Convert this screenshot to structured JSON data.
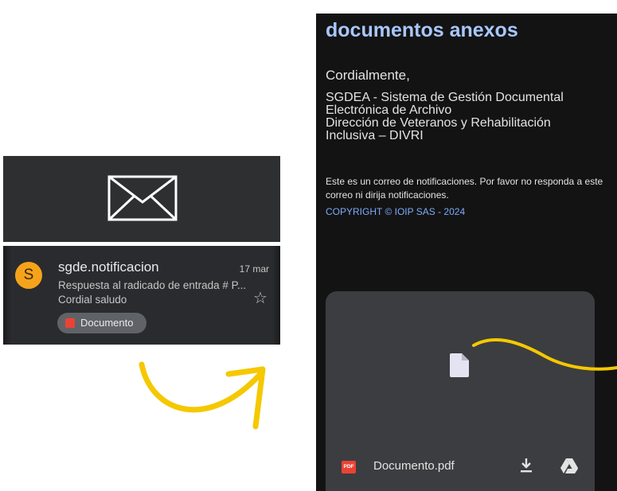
{
  "inbox_row": {
    "avatar_letter": "S",
    "sender": "sgde.notificacion",
    "date": "17 mar",
    "subject": "Respuesta al radicado de entrada # P...",
    "snippet": "Cordial saludo",
    "attachment_chip": "Documento",
    "star_icon": "star-outline-icon"
  },
  "envelope_icon": "envelope-outline-icon",
  "email": {
    "heading": "documentos anexos",
    "closing": "Cordialmente,",
    "signature_lines": [
      "SGDEA - Sistema de Gestión Documental",
      "Electrónica de Archivo",
      "Dirección de Veteranos y Rehabilitación",
      "Inclusiva – DIVRI"
    ],
    "notice": "Este es un correo de notificaciones. Por favor no responda a este correo ni dirija notificaciones.",
    "copyright": "COPYRIGHT © IOIP SAS - 2024"
  },
  "attachment": {
    "file_type_badge": "PDF",
    "filename": "Documento.pdf",
    "preview_icon": "document-icon",
    "actions": [
      "download-icon",
      "google-drive-icon"
    ]
  },
  "colors": {
    "annotation_yellow": "#f5c800",
    "avatar_orange": "#f6a31c",
    "link_blue": "#a8c7fa",
    "pdf_red": "#ea4335"
  }
}
